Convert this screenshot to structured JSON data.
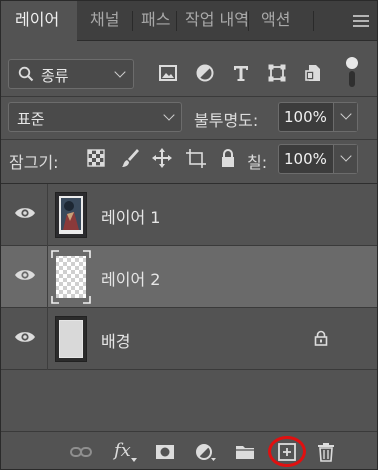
{
  "tabs": [
    {
      "label": "레이어",
      "active": true
    },
    {
      "label": "채널",
      "active": false
    },
    {
      "label": "패스",
      "active": false
    },
    {
      "label": "작업 내역",
      "active": false
    },
    {
      "label": "액션",
      "active": false
    }
  ],
  "filter": {
    "kind_label": "종류",
    "icons": [
      "image-filter-icon",
      "adjustment-filter-icon",
      "type-filter-icon",
      "shape-filter-icon",
      "smart-object-filter-icon"
    ]
  },
  "blend": {
    "mode": "표준",
    "opacity_label": "불투명도:",
    "opacity_value": "100%"
  },
  "lock": {
    "label": "잠그기:",
    "fill_label": "칠:",
    "fill_value": "100%"
  },
  "layers": [
    {
      "name": "레이어 1",
      "selected": false,
      "visible": true,
      "locked": false
    },
    {
      "name": "레이어 2",
      "selected": true,
      "visible": true,
      "locked": false
    },
    {
      "name": "배경",
      "selected": false,
      "visible": true,
      "locked": true
    }
  ],
  "bottom_toolbar": {
    "fx_label": "fx",
    "highlighted_tool": "new-layer",
    "highlight_color": "#e01010"
  },
  "colors": {
    "panel_bg": "#535353",
    "tab_bar_bg": "#3f3f3f",
    "selected_layer_bg": "#6a6a6a"
  }
}
